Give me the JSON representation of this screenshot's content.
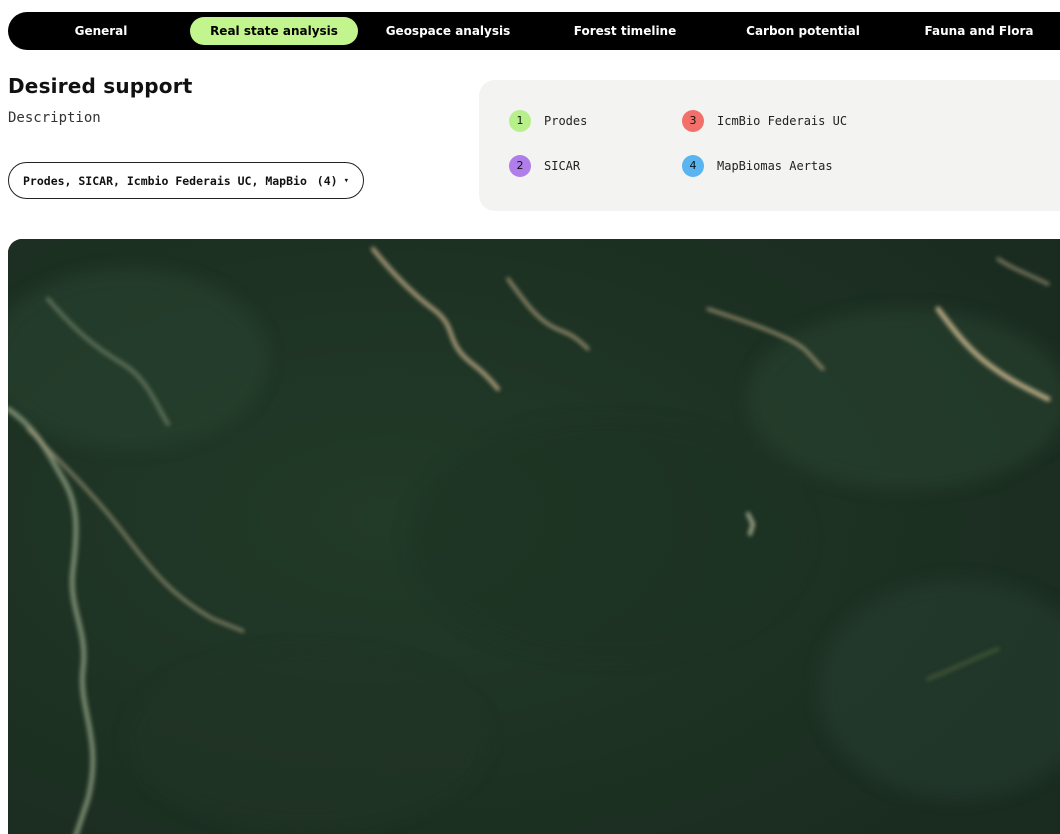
{
  "nav": {
    "tabs": [
      {
        "label": "General",
        "active": false
      },
      {
        "label": "Real state analysis",
        "active": true
      },
      {
        "label": "Geospace analysis",
        "active": false
      },
      {
        "label": "Forest timeline",
        "active": false
      },
      {
        "label": "Carbon potential",
        "active": false
      },
      {
        "label": "Fauna and Flora",
        "active": false
      }
    ],
    "active_color": "#c3f58e"
  },
  "section": {
    "title": "Desired support",
    "description": "Description"
  },
  "layer_select": {
    "value": "Prodes, SICAR, Icmbio Federais UC, MapBio...",
    "count": "(4)",
    "caret_icon": "chevron-down-icon"
  },
  "legend": {
    "items": [
      {
        "number": "1",
        "label": "Prodes",
        "color": "#b7f08a"
      },
      {
        "number": "2",
        "label": "SICAR",
        "color": "#b07ee8"
      },
      {
        "number": "3",
        "label": "IcmBio Federais UC",
        "color": "#f26f6a"
      },
      {
        "number": "4",
        "label": "MapBiomas Aertas",
        "color": "#5ab4f0"
      }
    ]
  },
  "map": {
    "type": "satellite-imagery",
    "base_color": "#1e3224"
  }
}
